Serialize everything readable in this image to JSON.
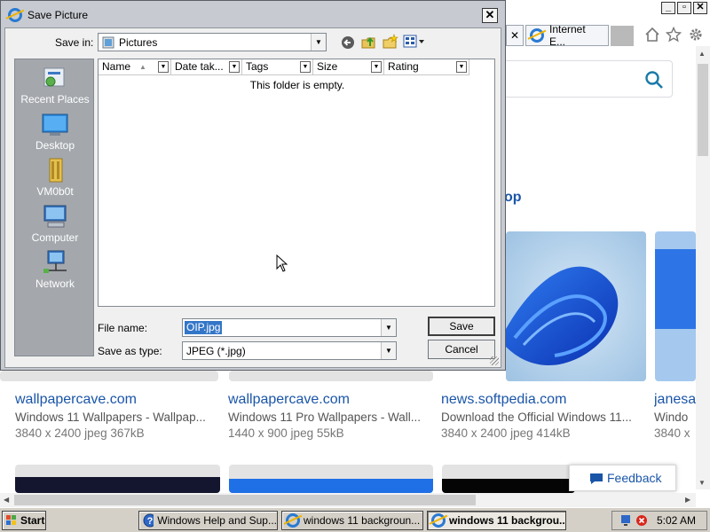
{
  "browser": {
    "tab_label": "Internet E...",
    "section_heading": "op",
    "results": [
      {
        "site": "wallpapercave.com",
        "title": "Windows 11 Wallpapers - Wallpap...",
        "meta": "3840 x 2400 jpeg 367kB"
      },
      {
        "site": "wallpapercave.com",
        "title": "Windows 11 Pro Wallpapers - Wall...",
        "meta": "1440 x 900 jpeg 55kB"
      },
      {
        "site": "news.softpedia.com",
        "title": "Download the Official Windows 11...",
        "meta": "3840 x 2400 jpeg 414kB"
      },
      {
        "site": "janesa",
        "title": "Windo",
        "meta": "3840 x"
      }
    ],
    "feedback_label": "Feedback"
  },
  "dialog": {
    "title": "Save Picture",
    "save_in_label": "Save in:",
    "save_in_value": "Pictures",
    "places": [
      {
        "label": "Recent Places",
        "icon": "recent-places-icon"
      },
      {
        "label": "Desktop",
        "icon": "desktop-icon"
      },
      {
        "label": "VM0b0t",
        "icon": "user-folder-icon"
      },
      {
        "label": "Computer",
        "icon": "computer-icon"
      },
      {
        "label": "Network",
        "icon": "network-icon"
      }
    ],
    "columns": [
      "Name",
      "Date tak...",
      "Tags",
      "Size",
      "Rating"
    ],
    "empty_message": "This folder is empty.",
    "file_name_label": "File name:",
    "file_name_value": "OIP.jpg",
    "save_type_label": "Save as type:",
    "save_type_value": "JPEG (*.jpg)",
    "save_button": "Save",
    "cancel_button": "Cancel"
  },
  "taskbar": {
    "start_label": "Start",
    "tasks": [
      {
        "label": "Windows Help and Sup...",
        "active": false
      },
      {
        "label": "windows 11 backgroun...",
        "active": false
      },
      {
        "label": "windows 11 backgrou...",
        "active": true
      }
    ],
    "clock": "5:02 AM"
  }
}
